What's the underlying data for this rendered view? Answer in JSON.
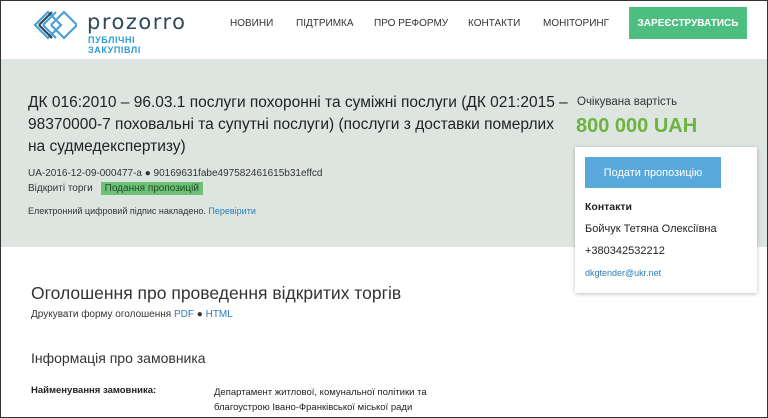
{
  "header": {
    "logo_name": "prozorro",
    "logo_sub": "ПУБЛІЧНІ ЗАКУПІВЛІ",
    "nav": [
      "НОВИНИ",
      "ПІДТРИМКА",
      "ПРО РЕФОРМУ",
      "КОНТАКТИ",
      "МОНІТОРИНГ"
    ],
    "register_label": "ЗАРЕЄСТРУВАТИСЬ"
  },
  "tender": {
    "title": "ДК 016:2010 – 96.03.1 послуги похоронні та суміжні послуги (ДК 021:2015 – 98370000-7 поховальні та супутні послуги) (послуги з доставки померлих на судмедекспертизу)",
    "id_line": "UA-2016-12-09-000477-a ● 90169631fabe497582461615b31effcd",
    "procedure": "Відкриті торги",
    "status": "Подання пропозицій",
    "signature_text": "Електронний цифровий підпис накладено.",
    "signature_link": "Перевірити"
  },
  "value": {
    "label": "Очікувана вартість",
    "amount": "800 000",
    "currency": "UAH"
  },
  "contact_card": {
    "offer_button": "Подати пропозицію",
    "heading": "Контакти",
    "person": "Бойчук Тетяна Олексіївна",
    "phone": "+380342532212",
    "email": "dkgtender@ukr.net"
  },
  "main": {
    "notice_title": "Оголошення про проведення відкритих торгів",
    "print_text": "Друкувати форму оголошення",
    "print_pdf": "PDF",
    "print_sep": "●",
    "print_html": "HTML",
    "customer_heading": "Інформація про замовника",
    "customer_name_label": "Найменування замовника:",
    "customer_name_value": "Департамент житлової, комунальної політики та благоустрою Івано-Франківської міської ради"
  },
  "colors": {
    "accent_green": "#6db33f",
    "register_green": "#4cbf80",
    "button_blue": "#59a8dc",
    "band_bg": "#dde5e1",
    "link_blue": "#2b7cbe"
  }
}
